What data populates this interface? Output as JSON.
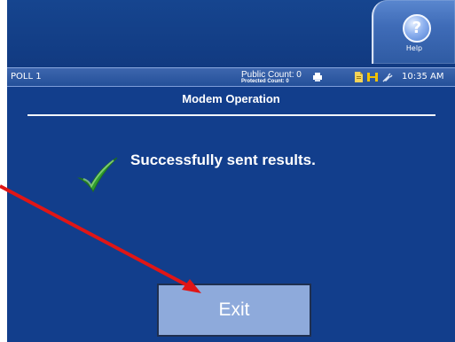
{
  "header": {
    "help_label": "Help",
    "help_icon_glyph": "?"
  },
  "status": {
    "poll": "POLL 1",
    "public_count": "Public Count: 0",
    "protected_count": "Protected Count: 0",
    "time": "10:35 AM"
  },
  "page": {
    "title": "Modem Operation",
    "message": "Successfully sent results."
  },
  "actions": {
    "exit_label": "Exit"
  },
  "icons": {
    "help": "help-icon",
    "success": "checkmark-icon",
    "printer": "printer-icon",
    "document": "document-icon",
    "battery": "battery-icon",
    "plug": "power-plug-icon",
    "arrow": "annotation-arrow-icon"
  },
  "colors": {
    "screen_background": "#123e8c",
    "help_tab": "#3f6cb8",
    "exit_button": "#8eaadb",
    "checkmark": "#2f9d2f",
    "annotation_arrow": "#e01616"
  }
}
